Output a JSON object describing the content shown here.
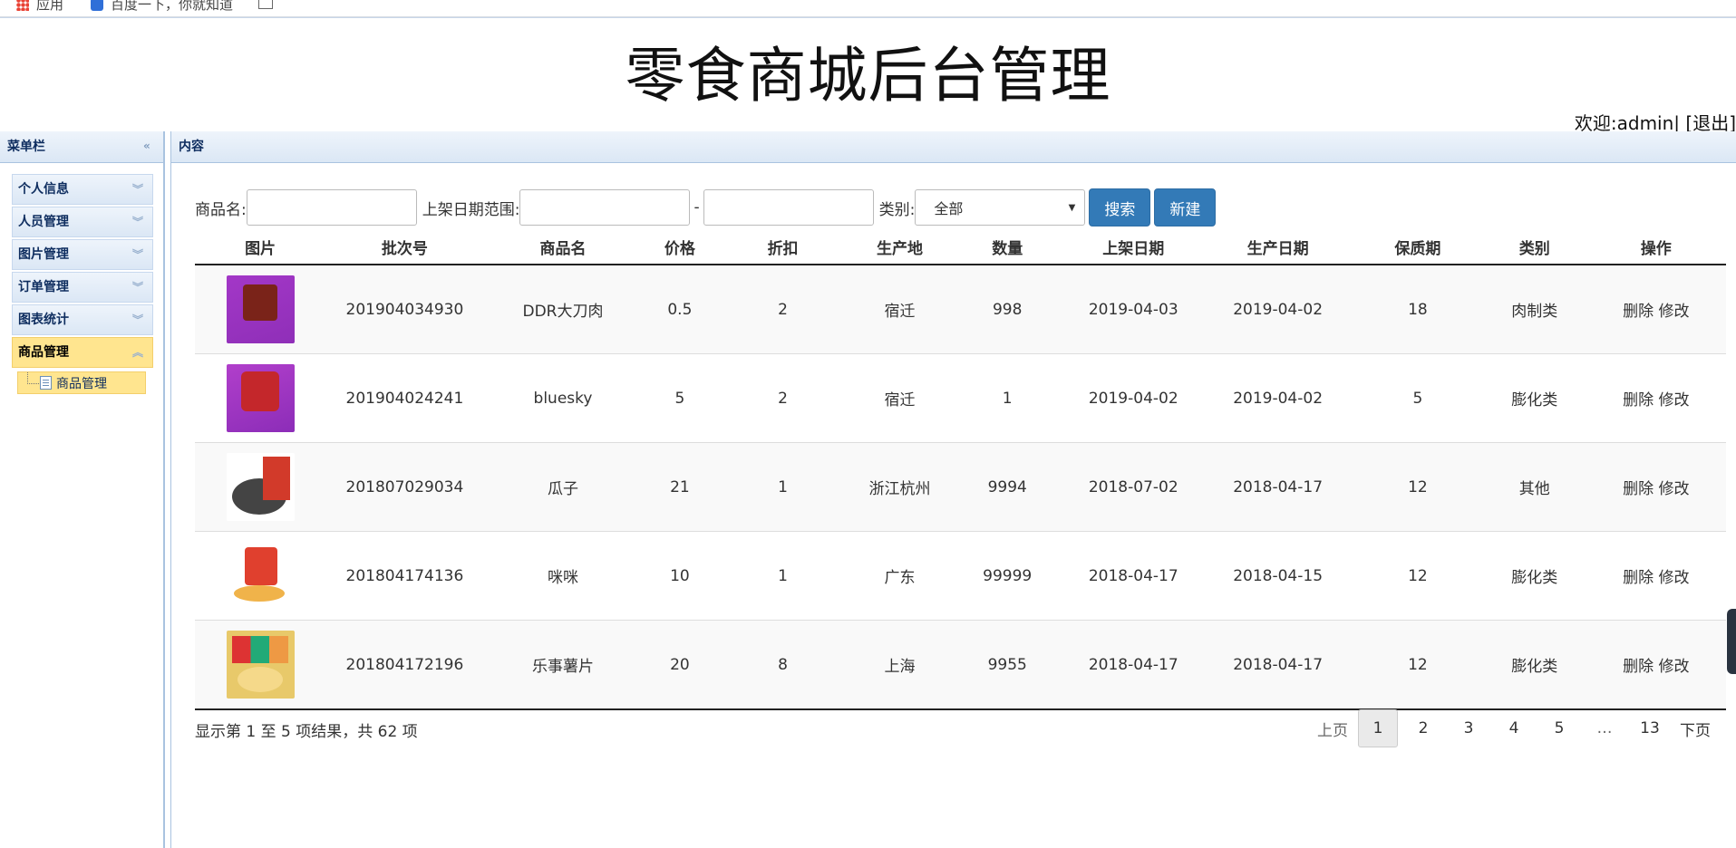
{
  "browser": {
    "bookmarks": [
      "应用",
      "百度一下，你就知道"
    ],
    "icons": [
      "apps-grid-icon",
      "baidu-icon",
      "page-icon"
    ]
  },
  "header": {
    "title": "零食商城后台管理",
    "welcome": "欢迎:admin| [退出]"
  },
  "sidebar": {
    "title": "菜单栏",
    "items": [
      {
        "label": "个人信息"
      },
      {
        "label": "人员管理"
      },
      {
        "label": "图片管理"
      },
      {
        "label": "订单管理"
      },
      {
        "label": "图表统计"
      },
      {
        "label": "商品管理"
      }
    ],
    "sub_item": "商品管理"
  },
  "content": {
    "title": "内容"
  },
  "search": {
    "name_label": "商品名:",
    "date_label": "上架日期范围:",
    "date_sep": "-",
    "type_label": "类别:",
    "type_value": "全部",
    "search_btn": "搜索",
    "new_btn": "新建"
  },
  "table": {
    "headers": [
      "图片",
      "批次号",
      "商品名",
      "价格",
      "折扣",
      "生产地",
      "数量",
      "上架日期",
      "生产日期",
      "保质期",
      "类别",
      "操作"
    ],
    "rows": [
      {
        "batch": "201904034930",
        "name": "DDR大刀肉",
        "price": "0.5",
        "discount": "2",
        "origin": "宿迁",
        "qty": "998",
        "shelf_date": "2019-04-03",
        "prod_date": "2019-04-02",
        "shelf_life": "18",
        "type": "肉制类",
        "delete": "删除",
        "edit": "修改"
      },
      {
        "batch": "201904024241",
        "name": "bluesky",
        "price": "5",
        "discount": "2",
        "origin": "宿迁",
        "qty": "1",
        "shelf_date": "2019-04-02",
        "prod_date": "2019-04-02",
        "shelf_life": "5",
        "type": "膨化类",
        "delete": "删除",
        "edit": "修改"
      },
      {
        "batch": "201807029034",
        "name": "瓜子",
        "price": "21",
        "discount": "1",
        "origin": "浙江杭州",
        "qty": "9994",
        "shelf_date": "2018-07-02",
        "prod_date": "2018-04-17",
        "shelf_life": "12",
        "type": "其他",
        "delete": "删除",
        "edit": "修改"
      },
      {
        "batch": "201804174136",
        "name": "咪咪",
        "price": "10",
        "discount": "1",
        "origin": "广东",
        "qty": "99999",
        "shelf_date": "2018-04-17",
        "prod_date": "2018-04-15",
        "shelf_life": "12",
        "type": "膨化类",
        "delete": "删除",
        "edit": "修改"
      },
      {
        "batch": "201804172196",
        "name": "乐事薯片",
        "price": "20",
        "discount": "8",
        "origin": "上海",
        "qty": "9955",
        "shelf_date": "2018-04-17",
        "prod_date": "2018-04-17",
        "shelf_life": "12",
        "type": "膨化类",
        "delete": "删除",
        "edit": "修改"
      }
    ]
  },
  "footer": {
    "info": "显示第 1 至 5 项结果，共 62 项",
    "prev": "上页",
    "pages": [
      "1",
      "2",
      "3",
      "4",
      "5",
      "…",
      "13"
    ],
    "next": "下页"
  },
  "colors": {
    "primary_button": "#337ab7",
    "active_menu": "#ffe58f",
    "panel_header": "#dbe7f5"
  }
}
